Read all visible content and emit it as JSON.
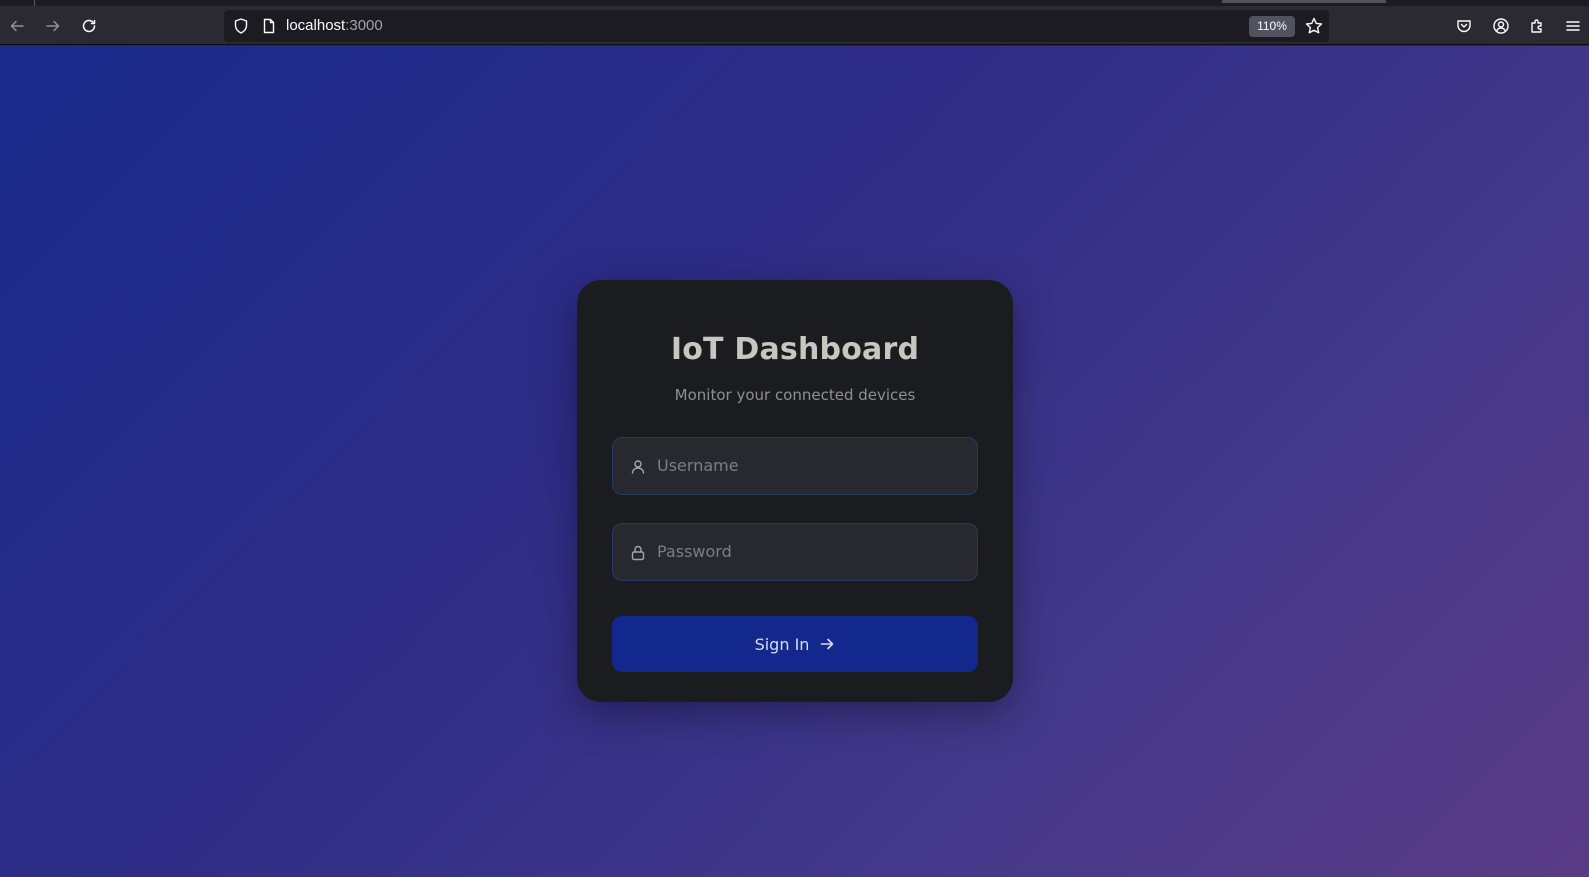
{
  "browser": {
    "url_host": "localhost",
    "url_port": ":3000",
    "zoom": "110%",
    "icons": {
      "back": "back-arrow-icon",
      "forward": "forward-arrow-icon",
      "reload": "reload-icon",
      "shield": "shield-icon",
      "page": "page-icon",
      "star": "star-icon",
      "pocket": "pocket-icon",
      "account": "account-icon",
      "extensions": "extensions-icon",
      "menu": "hamburger-menu-icon"
    }
  },
  "login": {
    "title": "IoT Dashboard",
    "subtitle": "Monitor your connected devices",
    "username_placeholder": "Username",
    "password_placeholder": "Password",
    "username_value": "",
    "password_value": "",
    "signin_label": "Sign In"
  },
  "colors": {
    "card_bg": "#1b1c1f",
    "button_bg": "#12288c",
    "gradient_start": "#1a2b8c",
    "gradient_end": "#5a3b86"
  }
}
